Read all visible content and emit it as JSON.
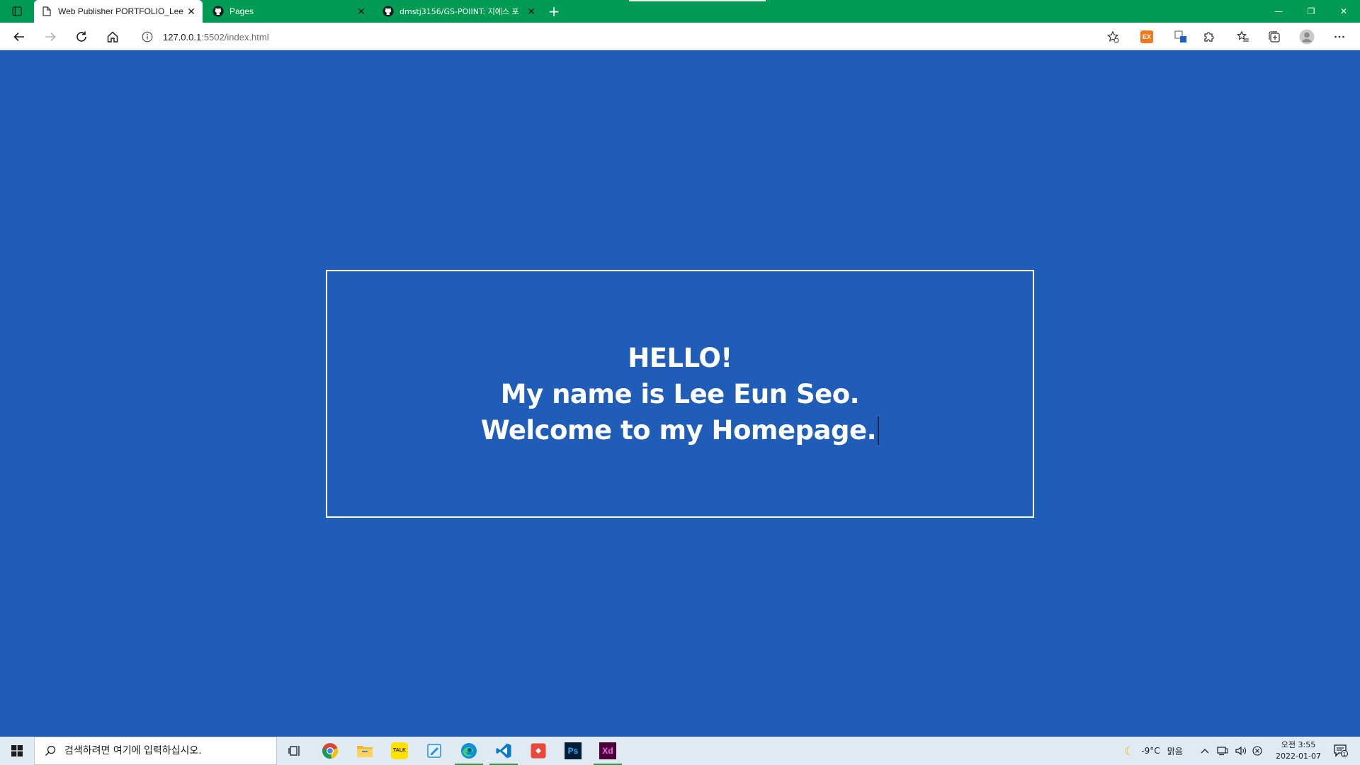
{
  "browser": {
    "tabs": [
      {
        "title": "Web Publisher PORTFOLIO_Lee E",
        "icon": "page-icon",
        "active": true
      },
      {
        "title": "Pages",
        "icon": "github-icon",
        "active": false
      },
      {
        "title": "dmstj3156/GS-POIINT: 지에스 포",
        "icon": "github-icon",
        "active": false
      }
    ],
    "new_tab_glyph": "+",
    "close_glyph": "✕",
    "window_controls": {
      "minimize": "—",
      "restore": "❐",
      "close": "✕"
    },
    "url": {
      "host": "127.0.0.1",
      "rest": ":5502/index.html"
    },
    "extension_badge": "EX"
  },
  "page": {
    "lines": [
      "HELLO!",
      "My name is Lee Eun Seo.",
      "Welcome to my Homepage."
    ]
  },
  "taskbar": {
    "search_placeholder": "검색하려면 여기에 입력하십시오.",
    "weather": {
      "temp": "-9°C",
      "condition": "맑음"
    },
    "clock": {
      "time": "오전 3:55",
      "date": "2022-01-07"
    },
    "notification_count": "1",
    "apps": [
      "task-view-icon",
      "chrome-icon",
      "file-explorer-icon",
      "kakaotalk-icon",
      "notepad-icon",
      "edge-icon",
      "vscode-icon",
      "git-icon",
      "photoshop-icon",
      "xd-icon"
    ],
    "app_labels": {
      "kakaotalk": "TALK",
      "photoshop": "Ps",
      "xd": "Xd"
    }
  },
  "colors": {
    "page_bg": "#1f5db8",
    "titlebar_bg": "#009b52",
    "box_border": "#ffffff",
    "text": "#ffffff"
  }
}
